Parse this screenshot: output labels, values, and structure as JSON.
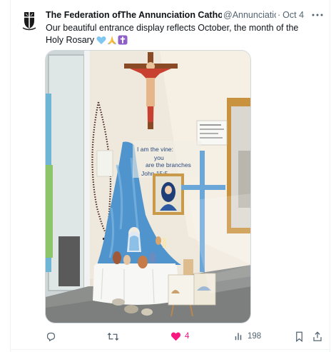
{
  "tweet": {
    "author_name": "The Federation ofThe Annunciation Catholic S",
    "handle": "@AnnunciationF",
    "separator": "·",
    "date": "Oct 4",
    "text": "Our beautiful entrance display reflects October, the month of the Holy Rosary",
    "emojis": [
      "light-blue-heart-icon",
      "praying-hands-icon",
      "latin-cross-icon"
    ],
    "media": {
      "banner_text": [
        "I am the vine:",
        "you",
        "are the branches",
        "John 15:5"
      ]
    }
  },
  "actions": {
    "reply_count": "",
    "retweet_count": "",
    "like_count": "4",
    "views_count": "198"
  },
  "colors": {
    "like": "#f91880",
    "muted": "#536471",
    "text": "#0f1419",
    "cloth": "#4f94cc",
    "wood_cross": "#6aa6d8"
  }
}
